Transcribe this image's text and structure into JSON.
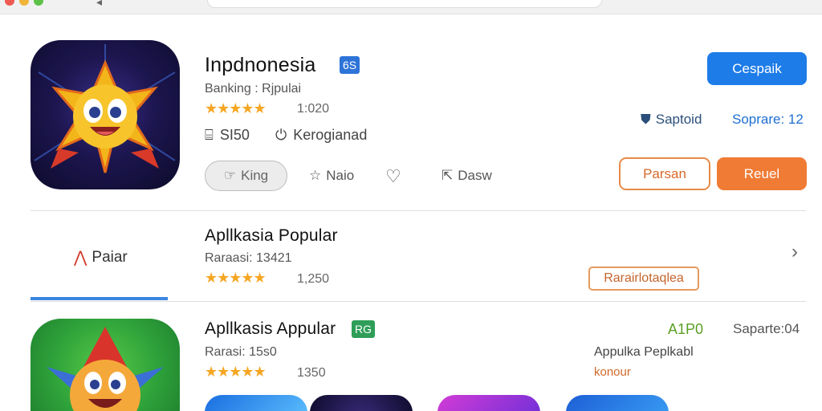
{
  "app1": {
    "name": "Inpdnonesia",
    "badge": "6S",
    "category": "Banking : Rjpulai",
    "stars": "★★★★★",
    "rating_count": "1:020",
    "size": "SI50",
    "download_label": "Kerogianad",
    "tags": {
      "pill": "King",
      "star_action": "Naio",
      "share_action": "Dasw"
    },
    "buttons": {
      "primary": "Cespaik",
      "outline": "Parsan",
      "orange": "Reuel"
    },
    "support": {
      "left": "Saptoid",
      "right": "Soprare: 12"
    }
  },
  "section2": {
    "tab": "Paiar",
    "title": "Apllkasia Popular",
    "subtitle": "Raraasi: 13421",
    "stars": "★★★★★",
    "rating_count": "1,250",
    "tag": "Rarairlotaqlea"
  },
  "app3": {
    "name": "Apllkasis Appular",
    "badge": "RG",
    "subtitle": "Rarasi: 15s0",
    "stars": "★★★★★",
    "rating_count": "1350",
    "green_value": "A1P0",
    "gray_value": "Saparte:04",
    "side_text": "Appulka Peplkabl",
    "side_link": "konour"
  },
  "colors": {
    "primary_blue": "#1d7ce8",
    "orange": "#ef7b35",
    "star": "#f5a623",
    "green_badge": "#2e9e58"
  }
}
